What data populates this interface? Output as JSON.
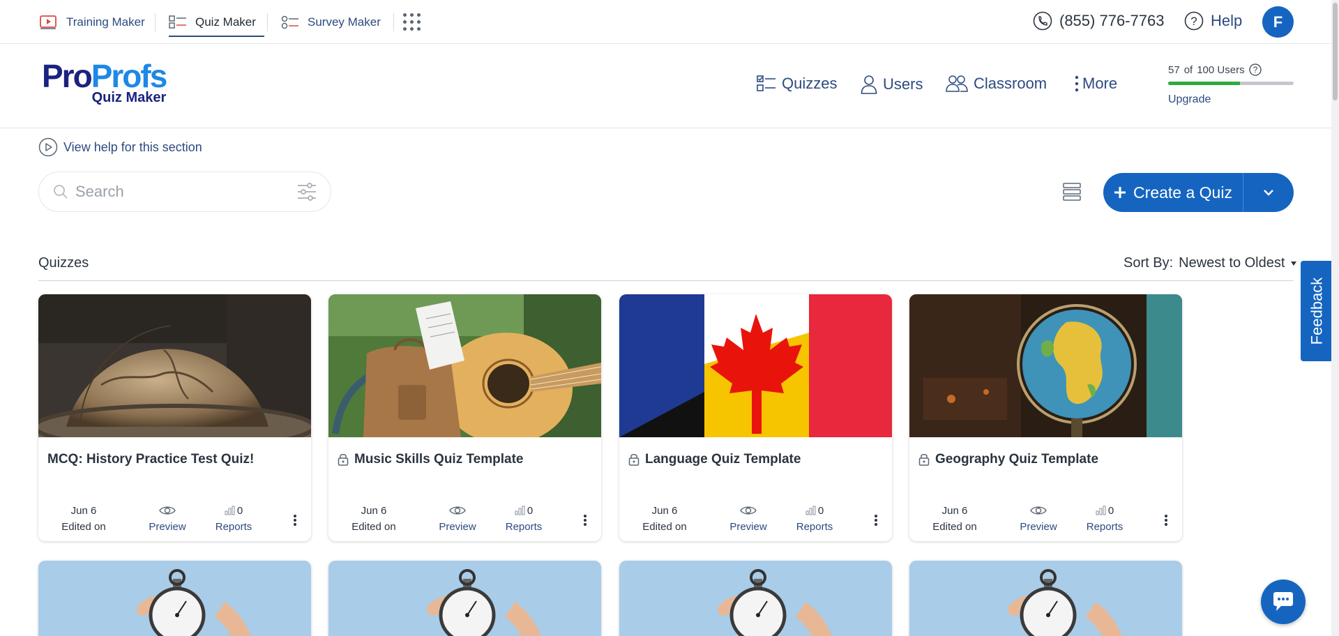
{
  "products": [
    {
      "label": "Training Maker",
      "active": false
    },
    {
      "label": "Quiz Maker",
      "active": true
    },
    {
      "label": "Survey Maker",
      "active": false
    }
  ],
  "topbar": {
    "phone": "(855) 776-7763",
    "help": "Help",
    "avatar_initial": "F"
  },
  "logo": {
    "pro": "Pro",
    "profs": "Profs",
    "sub": "Quiz Maker"
  },
  "nav": [
    {
      "label": "Quizzes"
    },
    {
      "label": "Users"
    },
    {
      "label": "Classroom"
    },
    {
      "label": "More"
    }
  ],
  "users_meter": {
    "used": "57",
    "of": "of",
    "total": "100 Users",
    "fraction": 0.57,
    "upgrade": "Upgrade"
  },
  "view_help": "View help for this section",
  "search": {
    "placeholder": "Search"
  },
  "create_button": {
    "label": "Create a Quiz"
  },
  "section": {
    "title": "Quizzes",
    "sort_label": "Sort By:",
    "sort_value": "Newest to Oldest"
  },
  "cards": [
    {
      "title": "MCQ: History Practice Test Quiz!",
      "locked": false,
      "date": "Jun 6",
      "edited_label": "Edited on",
      "preview_label": "Preview",
      "reports_count": "0",
      "reports_label": "Reports"
    },
    {
      "title": "Music Skills Quiz Template",
      "locked": true,
      "date": "Jun 6",
      "edited_label": "Edited on",
      "preview_label": "Preview",
      "reports_count": "0",
      "reports_label": "Reports"
    },
    {
      "title": "Language Quiz Template",
      "locked": true,
      "date": "Jun 6",
      "edited_label": "Edited on",
      "preview_label": "Preview",
      "reports_count": "0",
      "reports_label": "Reports"
    },
    {
      "title": "Geography Quiz Template",
      "locked": true,
      "date": "Jun 6",
      "edited_label": "Edited on",
      "preview_label": "Preview",
      "reports_count": "0",
      "reports_label": "Reports"
    }
  ],
  "feedback": "Feedback",
  "colors": {
    "primary": "#1565c0",
    "link": "#2d4a80",
    "meter": "#2eaa3f"
  }
}
